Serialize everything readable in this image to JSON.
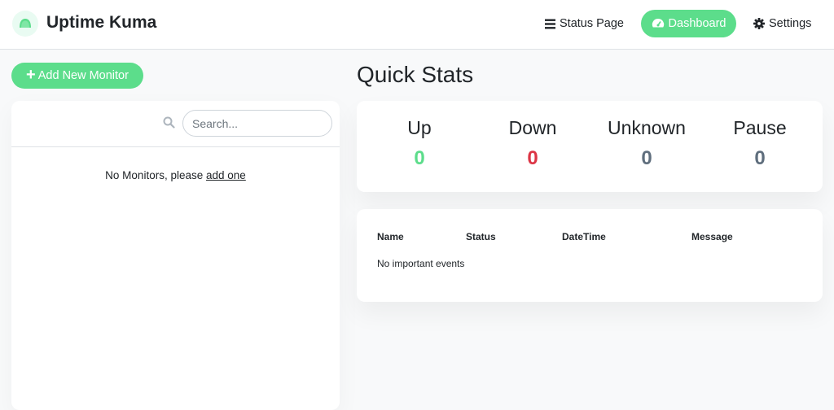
{
  "header": {
    "app_title": "Uptime Kuma",
    "nav": [
      {
        "label": "Status Page",
        "icon": "list-icon"
      },
      {
        "label": "Dashboard",
        "icon": "tachometer-icon",
        "active": true
      },
      {
        "label": "Settings",
        "icon": "gear-icon"
      }
    ]
  },
  "sidebar": {
    "add_monitor_label": "Add New Monitor",
    "search_placeholder": "Search...",
    "empty_text": "No Monitors, please",
    "empty_link": "add one"
  },
  "main": {
    "title": "Quick Stats",
    "stats": [
      {
        "label": "Up",
        "value": "0",
        "color": "#5cdd8b"
      },
      {
        "label": "Down",
        "value": "0",
        "color": "#dc3545"
      },
      {
        "label": "Unknown",
        "value": "0",
        "color": "#5f6e7d"
      },
      {
        "label": "Pause",
        "value": "0",
        "color": "#5f6e7d"
      }
    ],
    "events": {
      "columns": [
        "Name",
        "Status",
        "DateTime",
        "Message"
      ],
      "empty_text": "No important events"
    }
  },
  "colors": {
    "accent": "#5cdd8b",
    "danger": "#dc3545",
    "muted": "#5f6e7d"
  }
}
